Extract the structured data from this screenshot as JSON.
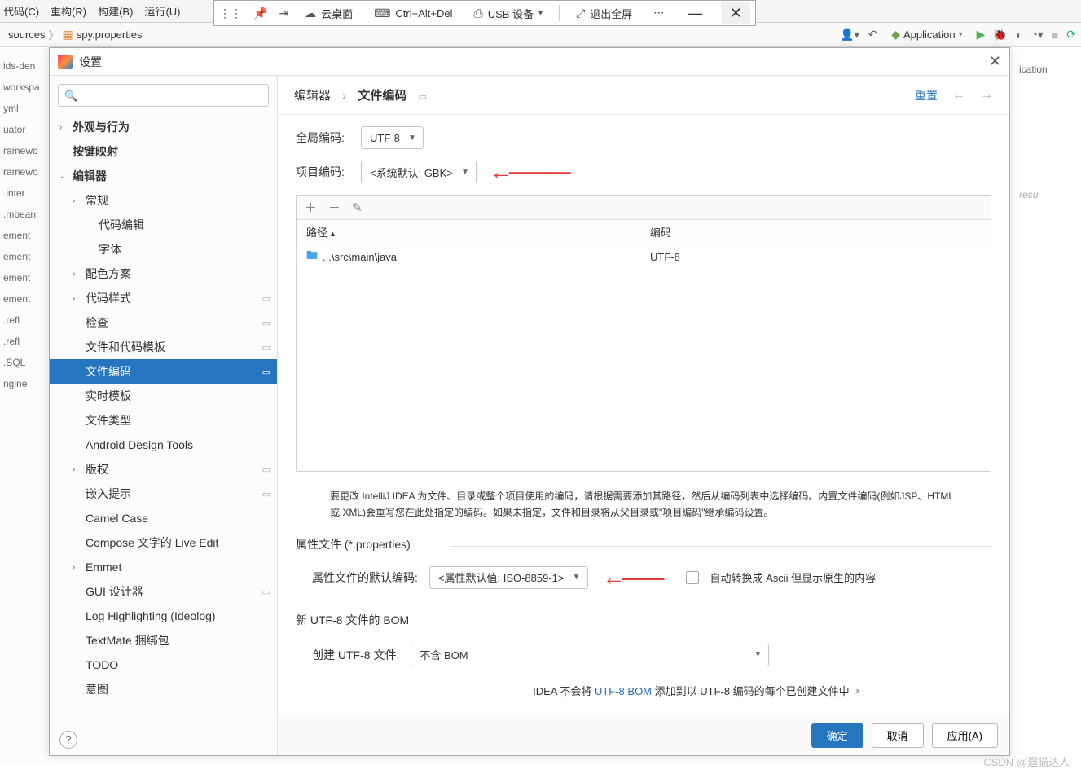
{
  "menu": {
    "code": "代码(C)",
    "refactor": "重构(R)",
    "build": "构建(B)",
    "run": "运行(U)"
  },
  "remote": {
    "pin": "",
    "cloud": "云桌面",
    "cad": "Ctrl+Alt+Del",
    "usb": "USB 设备",
    "exit": "退出全屏",
    "more": "⋯"
  },
  "ide": {
    "breadcrumb_sources": "sources",
    "breadcrumb_file": "spy.properties",
    "run_cfg": "Application"
  },
  "right_strip": {
    "ication": "ication"
  },
  "bg_left": {
    "items": [
      "ids-den",
      "workspa",
      "yml",
      "uator",
      "ramewo",
      "ramewo",
      ".inter",
      ".mbean",
      "ement",
      "ement",
      "ement",
      "ement",
      ".refl",
      ".refl",
      ".SQL",
      "ngine"
    ]
  },
  "dialog": {
    "title": "设置",
    "search_placeholder": "",
    "tree": [
      {
        "label": "外观与行为",
        "depth": 0,
        "chev": "›",
        "bold": true
      },
      {
        "label": "按键映射",
        "depth": 0,
        "chev": "",
        "bold": true
      },
      {
        "label": "编辑器",
        "depth": 0,
        "chev": "⌄",
        "bold": true
      },
      {
        "label": "常规",
        "depth": 1,
        "chev": "›"
      },
      {
        "label": "代码编辑",
        "depth": 2,
        "chev": ""
      },
      {
        "label": "字体",
        "depth": 2,
        "chev": ""
      },
      {
        "label": "配色方案",
        "depth": 1,
        "chev": "›"
      },
      {
        "label": "代码样式",
        "depth": 1,
        "chev": "›",
        "badge": "▭"
      },
      {
        "label": "检查",
        "depth": 1,
        "chev": "",
        "badge": "▭"
      },
      {
        "label": "文件和代码模板",
        "depth": 1,
        "chev": "",
        "badge": "▭"
      },
      {
        "label": "文件编码",
        "depth": 1,
        "chev": "",
        "badge": "▭",
        "selected": true
      },
      {
        "label": "实时模板",
        "depth": 1,
        "chev": ""
      },
      {
        "label": "文件类型",
        "depth": 1,
        "chev": ""
      },
      {
        "label": "Android Design Tools",
        "depth": 1,
        "chev": ""
      },
      {
        "label": "版权",
        "depth": 1,
        "chev": "›",
        "badge": "▭"
      },
      {
        "label": "嵌入提示",
        "depth": 1,
        "chev": "",
        "badge": "▭"
      },
      {
        "label": "Camel Case",
        "depth": 1,
        "chev": ""
      },
      {
        "label": "Compose 文字的 Live Edit",
        "depth": 1,
        "chev": ""
      },
      {
        "label": "Emmet",
        "depth": 1,
        "chev": "›"
      },
      {
        "label": "GUI 设计器",
        "depth": 1,
        "chev": "",
        "badge": "▭"
      },
      {
        "label": "Log Highlighting (Ideolog)",
        "depth": 1,
        "chev": ""
      },
      {
        "label": "TextMate 捆绑包",
        "depth": 1,
        "chev": ""
      },
      {
        "label": "TODO",
        "depth": 1,
        "chev": ""
      },
      {
        "label": "意图",
        "depth": 1,
        "chev": ""
      }
    ],
    "crumb_editor": "编辑器",
    "crumb_current": "文件编码",
    "reset": "重置",
    "global_label": "全局编码:",
    "global_value": "UTF-8",
    "project_label": "项目编码:",
    "project_value": "<系统默认: GBK>",
    "th_path": "路径",
    "th_enc": "编码",
    "row_path": "...\\src\\main\\java",
    "row_enc": "UTF-8",
    "hint": "要更改 IntelliJ IDEA 为文件、目录或整个项目使用的编码，请根据需要添加其路径，然后从编码列表中选择编码。内置文件编码(例如JSP、HTML 或 XML)会重写您在此处指定的编码。如果未指定，文件和目录将从父目录或\"项目编码\"继承编码设置。",
    "props_section": "属性文件 (*.properties)",
    "props_label": "属性文件的默认编码:",
    "props_value": "<属性默认值: ISO-8859-1>",
    "props_checkbox": "自动转换成 Ascii 但显示原生的内容",
    "bom_section": "新 UTF-8 文件的 BOM",
    "bom_label": "创建 UTF-8 文件:",
    "bom_value": "不含 BOM",
    "bom_hint_prefix": "IDEA 不会将 ",
    "bom_hint_link": "UTF-8 BOM",
    "bom_hint_suffix": " 添加到以 UTF-8 编码的每个已创建文件中",
    "ok": "确定",
    "cancel": "取消",
    "apply": "应用(A)"
  },
  "watermark": "CSDN @遛猫达人"
}
